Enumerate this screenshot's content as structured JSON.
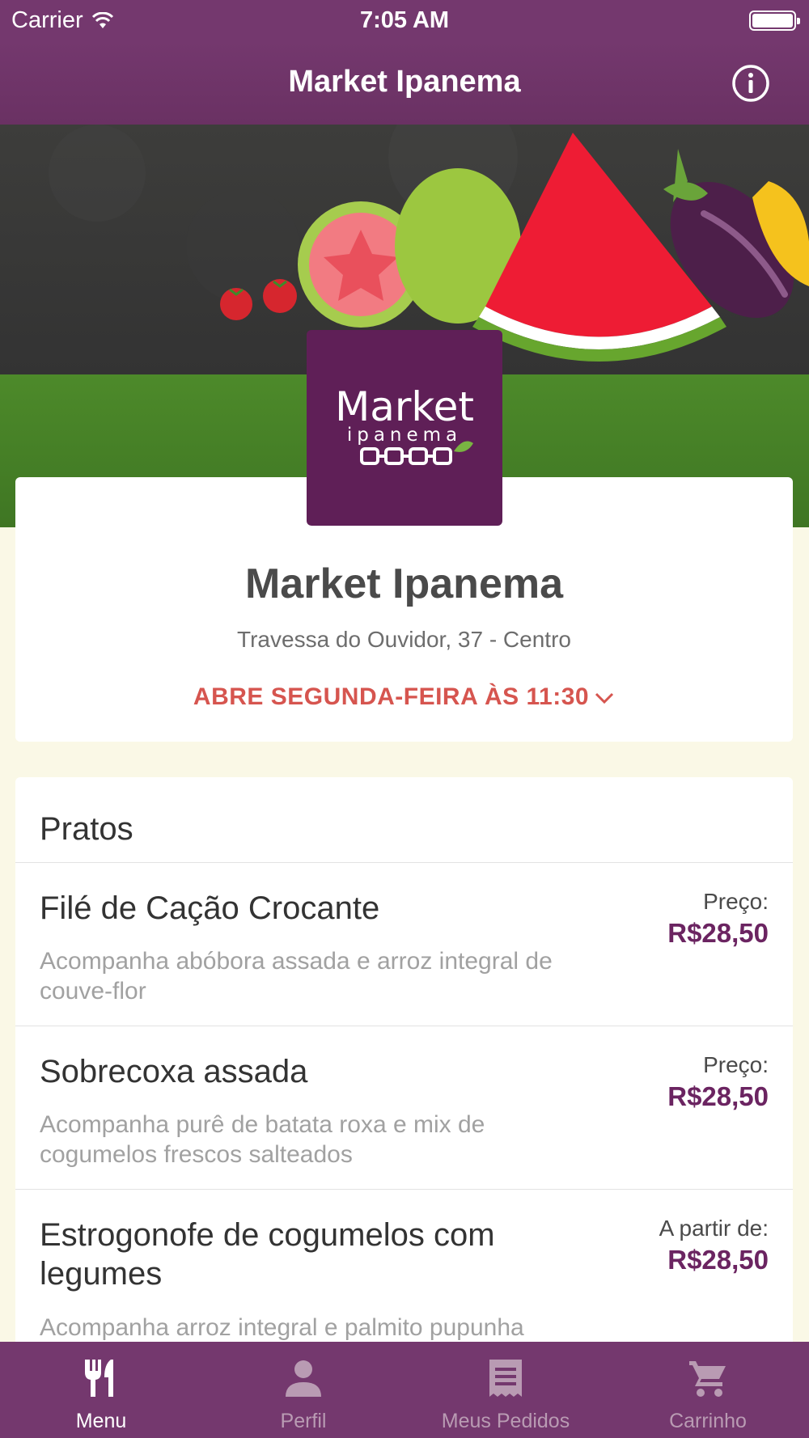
{
  "status_bar": {
    "carrier": "Carrier",
    "time": "7:05 AM"
  },
  "nav": {
    "title": "Market Ipanema",
    "info_icon": "info-icon"
  },
  "logo": {
    "word1": "Market",
    "word2": "ipanema",
    "colors": {
      "background": "#5f1f57",
      "leaf": "#79b342"
    }
  },
  "restaurant": {
    "name": "Market Ipanema",
    "address": "Travessa do Ouvidor, 37 - Centro",
    "hours": "ABRE SEGUNDA-FEIRA ÀS 11:30"
  },
  "menu": {
    "section_title": "Pratos",
    "items": [
      {
        "name": "Filé de Cação Crocante",
        "description": "Acompanha abóbora assada e arroz integral de couve-flor",
        "price_label": "Preço:",
        "price": "R$28,50"
      },
      {
        "name": "Sobrecoxa assada",
        "description": "Acompanha purê de batata roxa e mix de cogumelos frescos salteados",
        "price_label": "Preço:",
        "price": "R$28,50"
      },
      {
        "name": "Estrogonofe de cogumelos com legumes",
        "description": "Acompanha arroz integral e palmito pupunha",
        "price_label": "A partir de:",
        "price": "R$28,50"
      }
    ]
  },
  "tabs": [
    {
      "label": "Menu",
      "icon": "fork-knife-icon",
      "active": true
    },
    {
      "label": "Perfil",
      "icon": "person-icon",
      "active": false
    },
    {
      "label": "Meus Pedidos",
      "icon": "receipt-icon",
      "active": false
    },
    {
      "label": "Carrinho",
      "icon": "cart-icon",
      "active": false
    }
  ],
  "colors": {
    "brand_purple": "#74386e",
    "price_purple": "#6b2461",
    "hours_red": "#d6554f",
    "page_background": "#faf8e6"
  }
}
